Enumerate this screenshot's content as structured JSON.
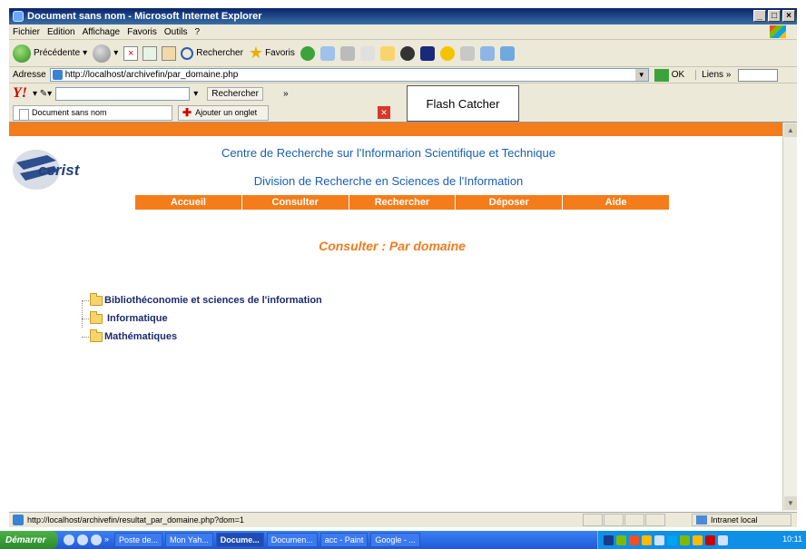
{
  "window": {
    "title": "Document sans nom - Microsoft Internet Explorer"
  },
  "menu": {
    "items": [
      "Fichier",
      "Edition",
      "Affichage",
      "Favoris",
      "Outils",
      "?"
    ]
  },
  "toolbar": {
    "back_label": "Précédente",
    "search_label": "Rechercher",
    "favorites_label": "Favoris"
  },
  "address": {
    "label": "Adresse",
    "url": "http://localhost/archivefin/par_domaine.php",
    "go_label": "OK",
    "links_label": "Liens »"
  },
  "yahoo": {
    "search_label": "Rechercher",
    "more": "»"
  },
  "flash": {
    "label": "Flash Catcher"
  },
  "tabs": {
    "current": "Document sans nom",
    "add_label": "Ajouter un onglet"
  },
  "site": {
    "logo_text": "cerist",
    "header1": "Centre de Recherche sur l'Informarion Scientifique et Technique",
    "header2": "Division de Recherche en Sciences de l'Information",
    "nav": [
      "Accueil",
      "Consulter",
      "Rechercher",
      "Déposer",
      "Aide"
    ],
    "heading": "Consulter : Par domaine",
    "domains": [
      "Bibliothéconomie et sciences de l'information",
      "Informatique",
      "Mathématiques"
    ]
  },
  "status": {
    "url": "http://localhost/archivefin/resultat_par_domaine.php?dom=1",
    "zone": "Intranet local"
  },
  "taskbar": {
    "start": "Démarrer",
    "tasks": [
      "Poste de...",
      "Mon Yah...",
      "Docume...",
      "Documen...",
      "acc - Paint",
      "Google - ..."
    ],
    "clock": "10:11"
  },
  "colors": {
    "accent": "#f57c1a",
    "link": "#1c2a6e",
    "header": "#1a5fb0"
  }
}
